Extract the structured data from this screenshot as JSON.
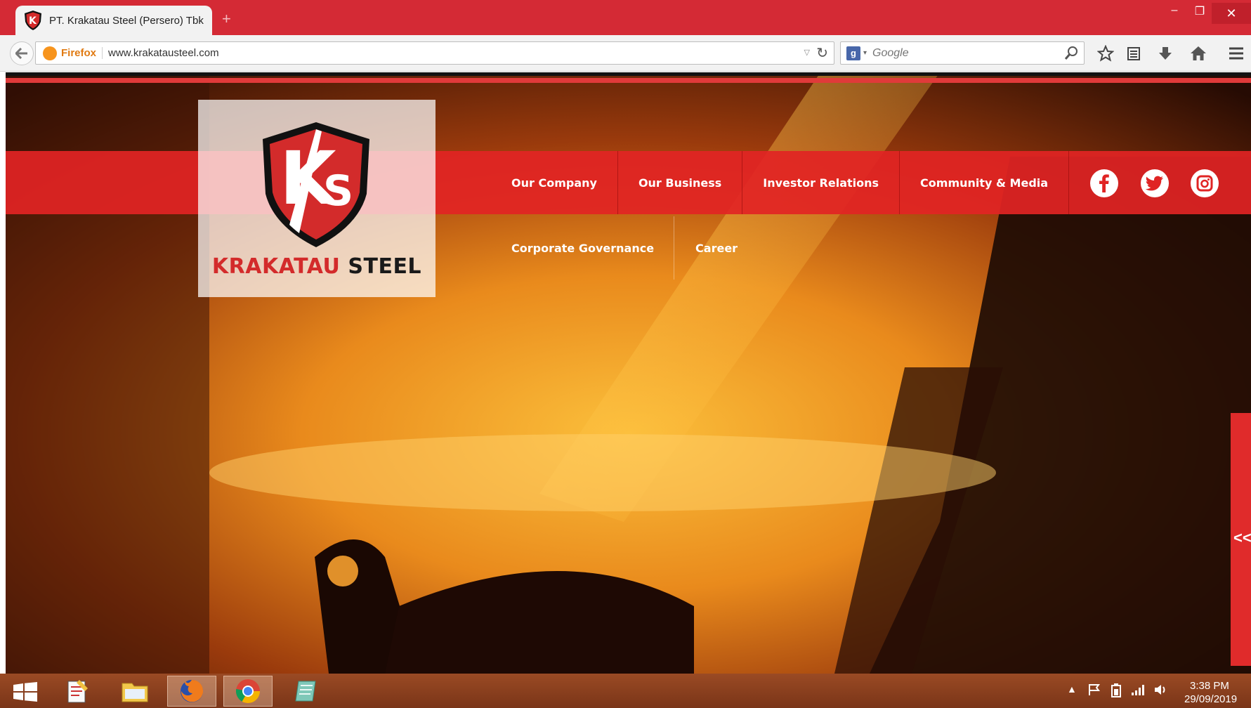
{
  "browser": {
    "tab_title": "PT. Krakatau Steel (Persero) Tbk",
    "new_tab_label": "+",
    "window_controls": {
      "minimize": "–",
      "maximize": "❐",
      "close": "✕"
    },
    "address_brand": "Firefox",
    "url": "www.krakatausteel.com",
    "search_placeholder": "Google",
    "search_engine_icon": "g-icon",
    "toolbar_icons": [
      "bookmark-star-icon",
      "reading-list-icon",
      "download-icon",
      "home-icon",
      "menu-icon"
    ]
  },
  "site": {
    "logo": {
      "monogram": "KS",
      "brand_red": "KRAKATAU",
      "brand_dark": "STEEL"
    },
    "menu": [
      {
        "label": "Our Company"
      },
      {
        "label": "Our Business"
      },
      {
        "label": "Investor Relations"
      },
      {
        "label": "Community & Media"
      }
    ],
    "submenu": [
      {
        "label": "Corporate Governance"
      },
      {
        "label": "Career"
      }
    ],
    "social": [
      "facebook-icon",
      "twitter-icon",
      "instagram-icon"
    ],
    "side_tab_label": "<<",
    "colors": {
      "brand_red": "#e02424",
      "dark": "#1a1a1a"
    }
  },
  "taskbar": {
    "apps": [
      "start-button",
      "notepad-app",
      "file-explorer-app",
      "firefox-app",
      "chrome-app",
      "notes-app"
    ],
    "tray_arrow": "▲",
    "time": "3:38 PM",
    "date": "29/09/2019"
  }
}
